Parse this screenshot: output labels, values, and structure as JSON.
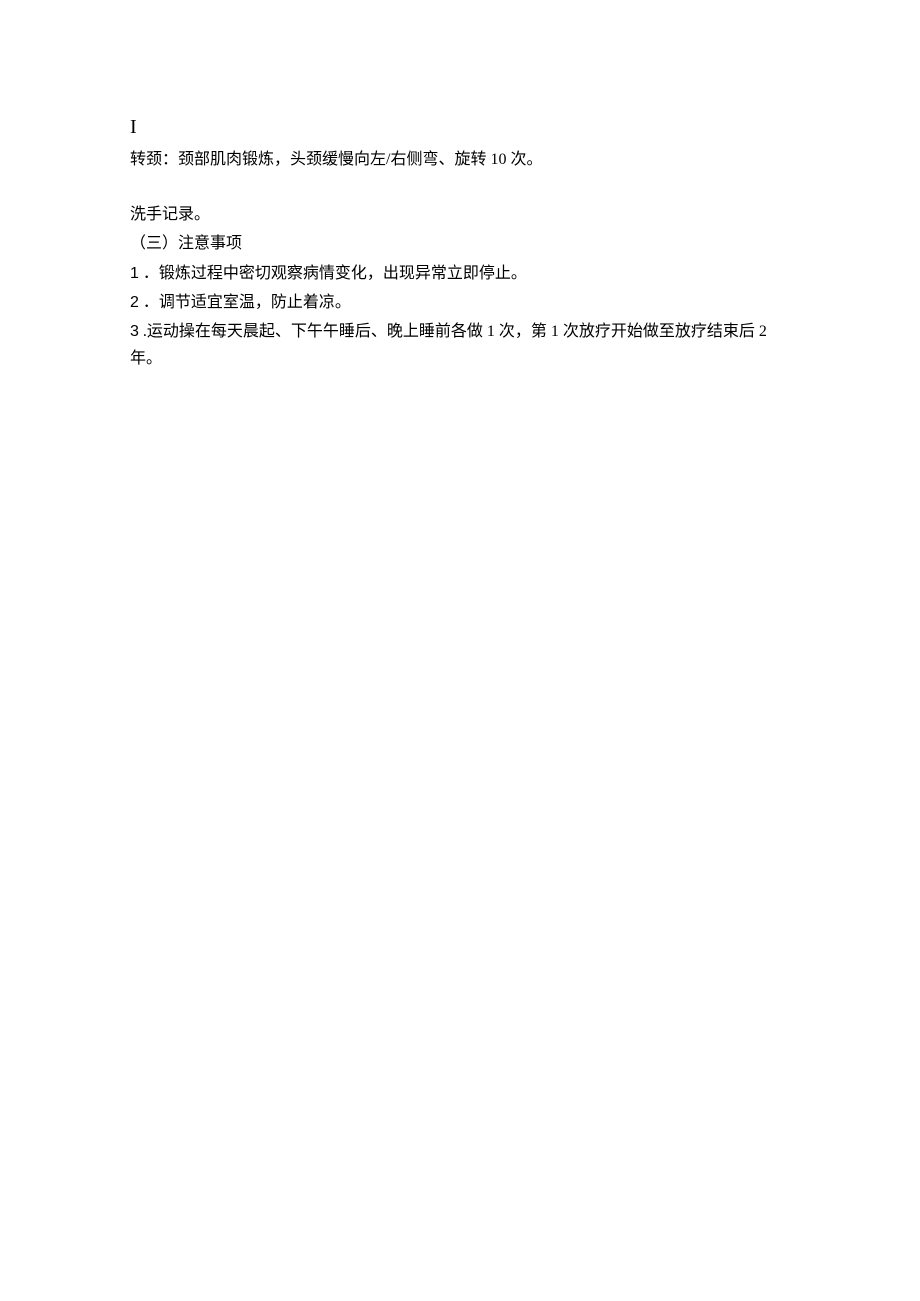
{
  "marker": "I",
  "line1": "转颈：颈部肌肉锻炼，头颈缓慢向左/右侧弯、旋转 10 次。",
  "line2": "洗手记录。",
  "section_header": "（三）注意事项",
  "items": [
    {
      "num": "1",
      "sep": " ．",
      "text": "锻炼过程中密切观察病情变化，出现异常立即停止。"
    },
    {
      "num": "2",
      "sep": " ．",
      "text": "调节适宜室温，防止着凉。"
    },
    {
      "num": "3",
      "sep": " .",
      "text": "运动操在每天晨起、下午午睡后、晚上睡前各做 1 次，第 1 次放疗开始做至放疗结束后 2 年。"
    }
  ]
}
